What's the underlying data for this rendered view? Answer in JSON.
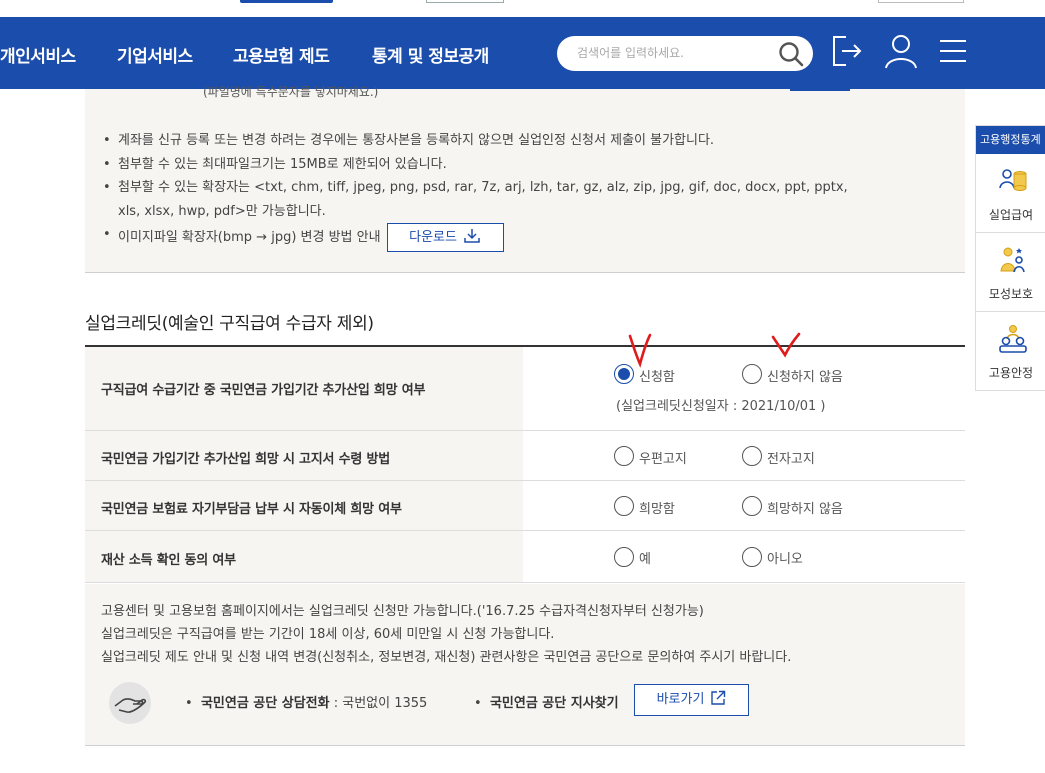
{
  "header": {
    "nav": [
      "개인서비스",
      "기업서비스",
      "고용보험 제도",
      "통계 및 정보공개"
    ],
    "search_placeholder": "검색어를 입력하세요.",
    "brand_color": "#1b4dac"
  },
  "notice": {
    "clipped_text": "(파일명에 특수문자를 넣지마세요.)",
    "items": [
      "계좌를 신규 등록 또는 변경 하려는 경우에는 통장사본을 등록하지 않으면 실업인정 신청서 제출이 불가합니다.",
      "첨부할 수 있는 최대파일크기는 15MB로 제한되어 있습니다.",
      "첨부할 수 있는 확장자는 <txt, chm, tiff, jpeg, png, psd, rar, 7z, arj, lzh, tar, gz, alz, zip, jpg, gif, doc, docx, ppt, pptx,",
      "xls, xlsx, hwp, pdf>만 가능합니다.",
      "이미지파일 확장자(bmp → jpg) 변경 방법 안내"
    ],
    "download_label": "다운로드"
  },
  "section": {
    "title": "실업크레딧(예술인 구직급여 수급자 제외)"
  },
  "form": {
    "rows": [
      {
        "label": "구직급여 수급기간 중 국민연금 가입기간 추가산입 희망 여부",
        "opt1": "신청함",
        "opt2": "신청하지 않음",
        "selected": 1,
        "note": "(실업크레딧신청일자 : 2021/10/01 )"
      },
      {
        "label": "국민연금 가입기간 추가산입 희망 시 고지서 수령 방법",
        "opt1": "우편고지",
        "opt2": "전자고지",
        "selected": 0
      },
      {
        "label": "국민연금 보험료 자기부담금 납부 시 자동이체 희망 여부",
        "opt1": "희망함",
        "opt2": "희망하지 않음",
        "selected": 0
      },
      {
        "label": "재산 소득 확인 동의 여부",
        "opt1": "예",
        "opt2": "아니오",
        "selected": 0
      }
    ]
  },
  "info": {
    "lines": [
      "고용센터 및 고용보험 홈페이지에서는 실업크레딧 신청만 가능합니다.('16.7.25 수급자격신청자부터 신청가능)",
      "실업크레딧은 구직급여를 받는 기간이 18세 이상, 60세 미만일 시 신청 가능합니다.",
      "실업크레딧 제도 안내 및 신청 내역 변경(신청취소, 정보변경, 재신청) 관련사항은 국민연금 공단으로 문의하여 주시기 바랍니다."
    ],
    "phone_label": "국민연금 공단 상담전화",
    "phone_value": ": 국번없이 1355",
    "branch_label": "국민연금 공단 지사찾기",
    "go_label": "바로가기"
  },
  "quick_menu": {
    "title": "고용행정통계",
    "items": [
      "실업급여",
      "모성보호",
      "고용안정"
    ]
  }
}
